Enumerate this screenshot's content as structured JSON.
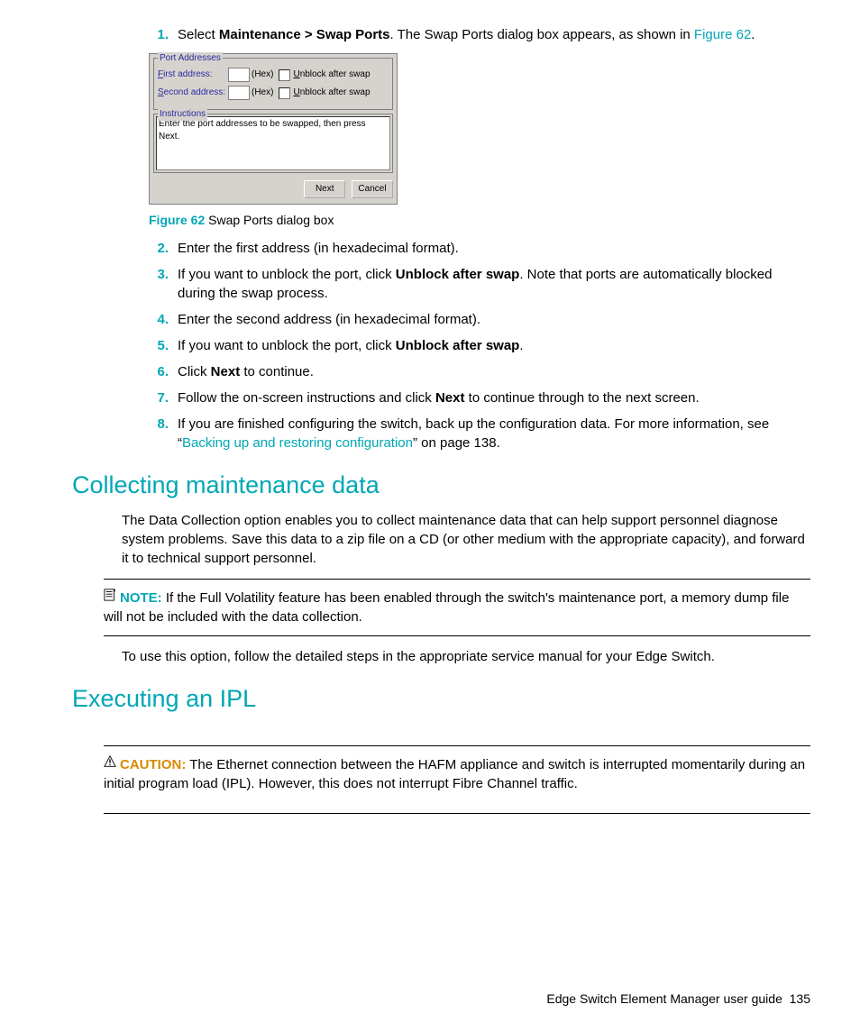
{
  "steps": {
    "s1a": "Select ",
    "s1b": "Maintenance > Swap Ports",
    "s1c": ". The Swap Ports dialog box appears, as shown in ",
    "s1link": "Figure 62",
    "s1d": ".",
    "s2": "Enter the first address (in hexadecimal format).",
    "s3a": "If you want to unblock the port, click ",
    "s3b": "Unblock after swap",
    "s3c": ". Note that ports are automatically blocked during the swap process.",
    "s4": "Enter the second address (in hexadecimal format).",
    "s5a": "If you want to unblock the port, click ",
    "s5b": "Unblock after swap",
    "s5c": ".",
    "s6a": "Click ",
    "s6b": "Next",
    "s6c": " to continue.",
    "s7a": "Follow the on-screen instructions and click ",
    "s7b": "Next",
    "s7c": " to continue through to the next screen.",
    "s8a": "If you are finished configuring the switch, back up the configuration data. For more information, see “",
    "s8link": "Backing up and restoring configuration",
    "s8b": "” on page 138."
  },
  "nums": {
    "n1": "1.",
    "n2": "2.",
    "n3": "3.",
    "n4": "4.",
    "n5": "5.",
    "n6": "6.",
    "n7": "7.",
    "n8": "8."
  },
  "dialog": {
    "groupPort": "Port Addresses",
    "firstAddrPrefix": "F",
    "firstAddrRest": "irst address:",
    "secondAddrPrefix": "S",
    "secondAddrRest": "econd address:",
    "hex": "(Hex)",
    "unblockPrefix": "U",
    "unblockRest": "nblock after swap",
    "groupInstr": "Instructions",
    "instrText": "Enter the port addresses to be swapped, then press Next.",
    "next": "Next",
    "cancel": "Cancel"
  },
  "figure": {
    "num": "Figure 62",
    "caption": " Swap Ports dialog box"
  },
  "sections": {
    "collecting": "Collecting maintenance data",
    "executing": "Executing an IPL"
  },
  "paras": {
    "collectP": "The Data Collection option enables you to collect maintenance data that can help support personnel diagnose system problems. Save this data to a zip file on a CD (or other medium with the appropriate capacity), and forward it to technical support personnel.",
    "afterNote": "To use this option, follow the detailed steps in the appropriate service manual for your Edge Switch."
  },
  "note": {
    "label": "NOTE:",
    "text": "   If the Full Volatility feature has been enabled through the switch's maintenance port, a memory dump file will not be included with the data collection."
  },
  "caution": {
    "label": "CAUTION:",
    "text": "   The Ethernet connection between the HAFM appliance and switch is interrupted momentarily during an initial program load (IPL). However, this does not interrupt Fibre Channel traffic."
  },
  "footer": {
    "text": "Edge Switch Element Manager user guide",
    "page": "135"
  }
}
